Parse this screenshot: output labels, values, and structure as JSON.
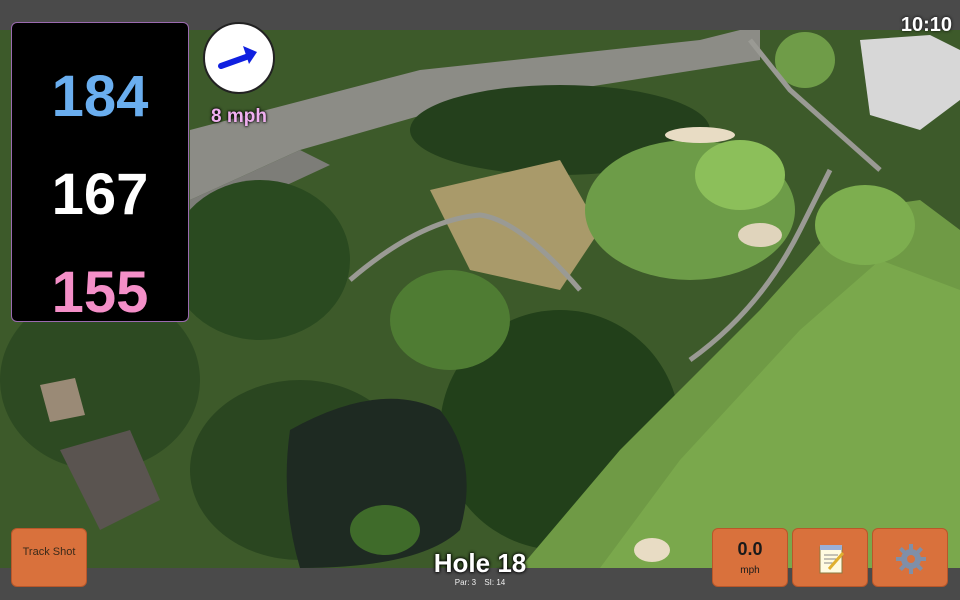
{
  "clock": "10:10",
  "distances": {
    "back": "184",
    "middle": "167",
    "front": "155"
  },
  "wind": {
    "speed_label": "8 mph",
    "arrow_color": "#1020e0",
    "icon": "wind-arrow-icon"
  },
  "hole": {
    "title": "Hole 18",
    "par": "Par: 3",
    "si": "SI: 14"
  },
  "buttons": {
    "track_shot": "Track Shot",
    "wind_value": "0.0",
    "wind_unit": "mph",
    "notes_icon": "notepad-icon",
    "settings_icon": "gear-icon"
  },
  "colors": {
    "back": "#6aaeef",
    "middle": "#ffffff",
    "front": "#f48fc8",
    "button": "#d9713c"
  }
}
